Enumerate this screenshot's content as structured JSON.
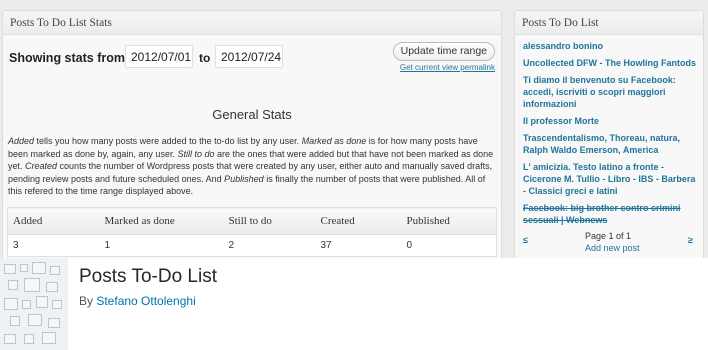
{
  "stats_panel": {
    "title": "Posts To Do List Stats",
    "range_label": "Showing stats from",
    "from_date": "2012/07/01",
    "to_label": "to",
    "to_date": "2012/07/24",
    "update_button": "Update time range",
    "permalink": "Get current view permalink",
    "general_title": "General Stats",
    "description": {
      "p1": "Added",
      "p2": " tells you how many posts were added to the to-do list by any user. ",
      "p3": "Marked as done",
      "p4": " is for how many posts have been marked as done by, again, any user. ",
      "p5": "Still to do",
      "p6": " are the ones that were added but that have not been marked as done yet. ",
      "p7": "Created",
      "p8": " counts the number of Wordpress posts that were created by any user, either auto and manually saved drafts, pending review posts and future scheduled ones. And ",
      "p9": "Published",
      "p10": " is finally the number of posts that were published. All of this refered to the time range displayed above."
    },
    "table": {
      "headers": [
        "Added",
        "Marked as done",
        "Still to do",
        "Created",
        "Published"
      ],
      "row": [
        "3",
        "1",
        "2",
        "37",
        "0"
      ]
    }
  },
  "todo_panel": {
    "title": "Posts To Do List",
    "items": [
      {
        "text": "alessandro bonino",
        "done": false
      },
      {
        "text": "Uncollected DFW - The Howling Fantods",
        "done": false
      },
      {
        "text": "Ti diamo il benvenuto su Facebook: accedi, iscriviti o scopri maggiori informazioni",
        "done": false
      },
      {
        "text": "Il professor Morte",
        "done": false
      },
      {
        "text": "Trascendentalismo, Thoreau, natura, Ralph Waldo Emerson, America",
        "done": false
      },
      {
        "text": "L' amicizia. Testo latino a fronte - Cicerone M. Tullio - Libro - IBS - Barbera - Classici greci e latini",
        "done": false
      },
      {
        "text": "Facebook: big brother contro crimini sessuali | Webnews",
        "done": true
      }
    ],
    "prev": "≤",
    "next": "≥",
    "page_info": "Page 1 of 1",
    "add_new": "Add new post"
  },
  "plugin": {
    "name": "Posts To-Do List",
    "by": "By ",
    "author": "Stefano Ottolenghi"
  }
}
